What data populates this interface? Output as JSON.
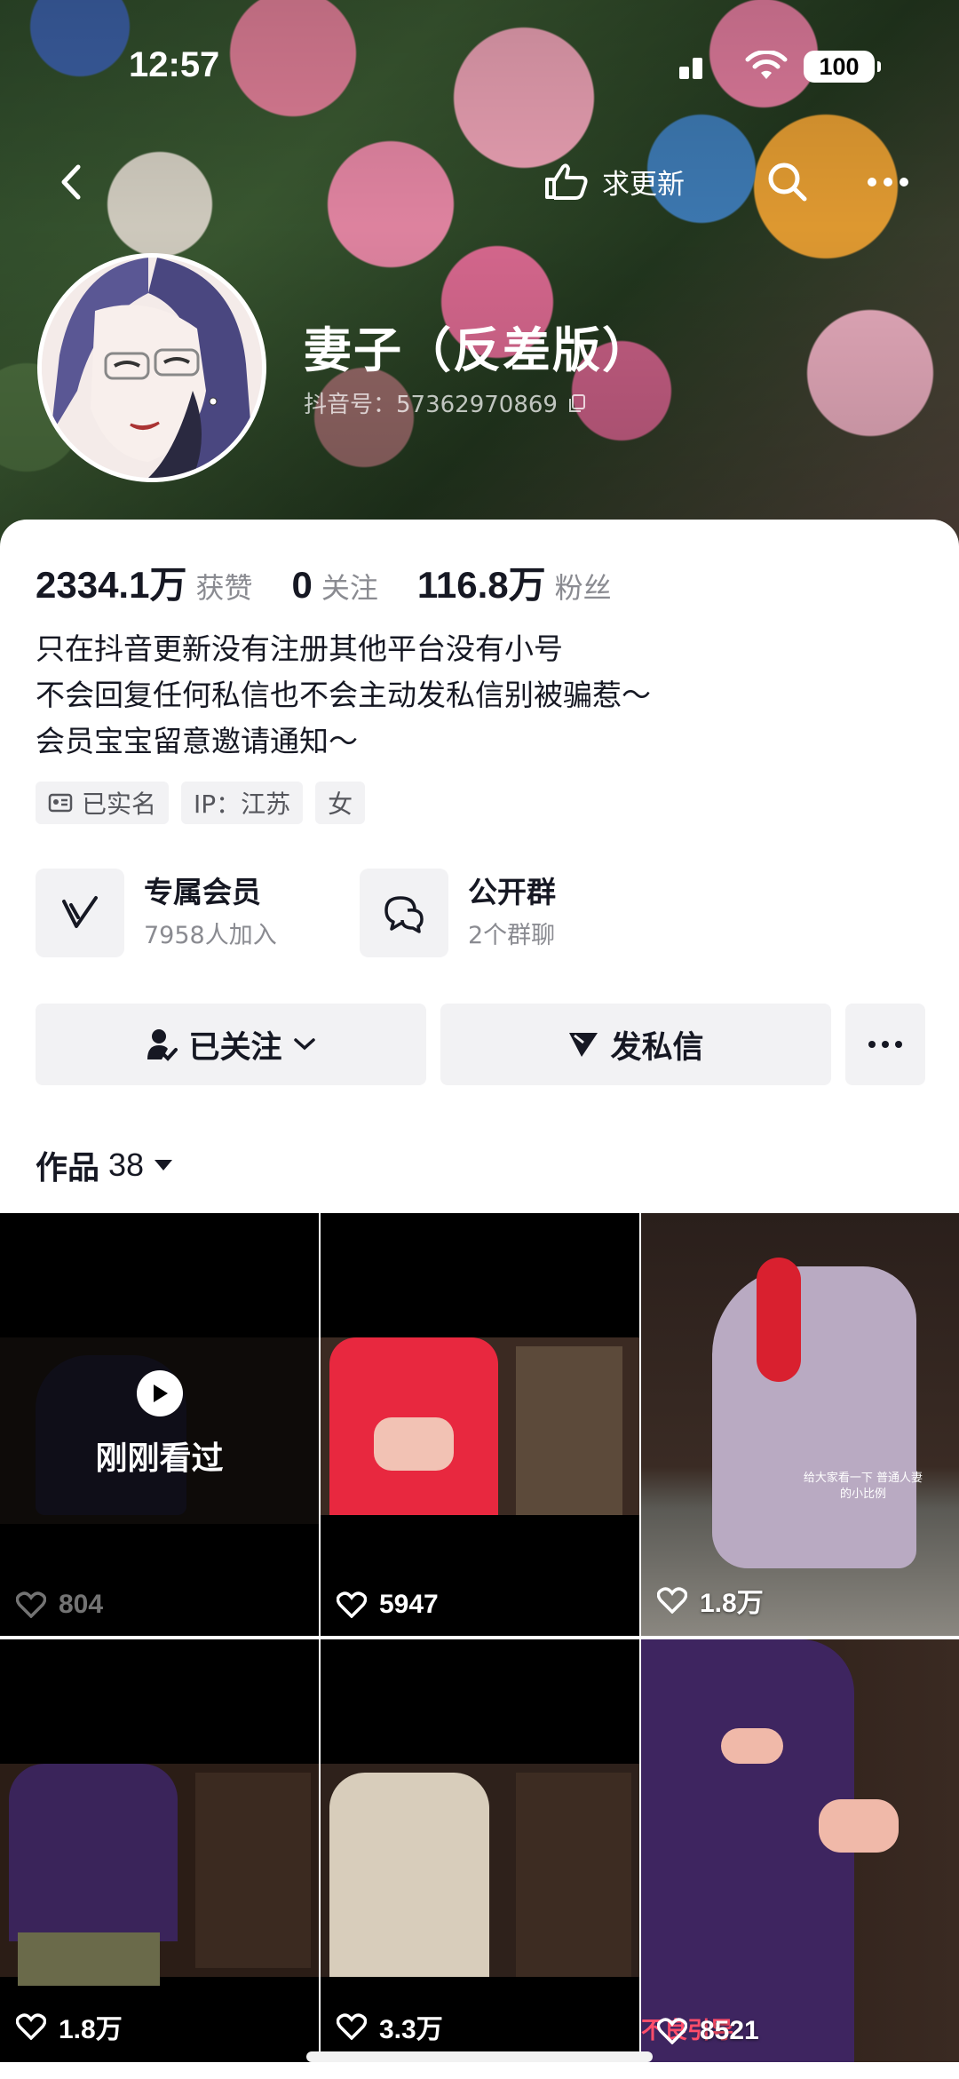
{
  "status_bar": {
    "time": "12:57",
    "battery": "100"
  },
  "nav": {
    "update_label": "求更新"
  },
  "profile": {
    "name": "妻子（反差版）",
    "douyin_id": "抖音号：57362970869"
  },
  "stats": [
    {
      "value": "2334.1万",
      "label": "获赞"
    },
    {
      "value": "0",
      "label": "关注"
    },
    {
      "value": "116.8万",
      "label": "粉丝"
    }
  ],
  "bio": [
    "只在抖音更新没有注册其他平台没有小号",
    "不会回复任何私信也不会主动发私信别被骗惹～",
    "会员宝宝留意邀请通知～"
  ],
  "tags": [
    "已实名",
    "IP：江苏",
    "女"
  ],
  "features": [
    {
      "title": "专属会员",
      "subtitle": "7958人加入",
      "icon": "v-badge-icon"
    },
    {
      "title": "公开群",
      "subtitle": "2个群聊",
      "icon": "chat-bubbles-icon"
    }
  ],
  "actions": {
    "follow_label": "已关注",
    "message_label": "发私信"
  },
  "works": {
    "label": "作品",
    "count": "38"
  },
  "videos": [
    {
      "likes": "804",
      "seen_label": "刚刚看过"
    },
    {
      "likes": "5947"
    },
    {
      "likes": "1.8万",
      "caption": "给大家看一下 普通人妻的小比例"
    },
    {
      "likes": "1.8万"
    },
    {
      "likes": "3.3万"
    },
    {
      "likes": "8521",
      "warning": "不良引导"
    }
  ],
  "colors": {
    "accent_text": "#161823",
    "muted_text": "#8a8b91",
    "chip_bg": "#f2f2f4"
  }
}
